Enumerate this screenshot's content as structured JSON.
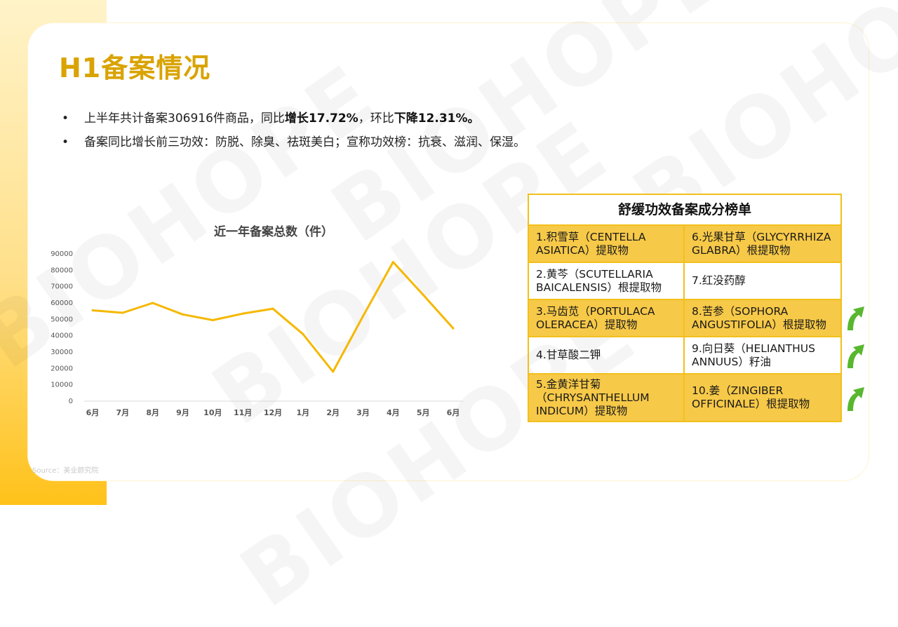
{
  "page": {
    "title": "H1备案情况",
    "source": "Source：美业颜究院",
    "watermark": "BIOHOPE"
  },
  "bullets": [
    {
      "parts": [
        {
          "text": "上半年共计备案306916件商品，同比",
          "bold": false
        },
        {
          "text": "增长17.72%",
          "bold": true
        },
        {
          "text": "，环比",
          "bold": false
        },
        {
          "text": "下降12.31%。",
          "bold": true
        }
      ]
    },
    {
      "parts": [
        {
          "text": "备案同比增长前三功效：防脱、除臭、祛斑美白；宣称功效榜：抗衰、滋润、保湿。",
          "bold": false
        }
      ]
    }
  ],
  "chart_data": {
    "type": "line",
    "title": "近一年备案总数（件）",
    "xlabel": "",
    "ylabel": "",
    "categories": [
      "6月",
      "7月",
      "8月",
      "9月",
      "10月",
      "11月",
      "12月",
      "1月",
      "2月",
      "3月",
      "4月",
      "5月",
      "6月"
    ],
    "series": [
      {
        "values": [
          55500,
          54000,
          60000,
          53000,
          49500,
          53500,
          56500,
          41000,
          18000,
          52000,
          85000,
          65000,
          44500
        ]
      }
    ],
    "ylim": [
      0,
      90000
    ],
    "yticks": [
      0,
      10000,
      20000,
      30000,
      40000,
      50000,
      60000,
      70000,
      80000,
      90000
    ],
    "line_color": "#f5b800",
    "grid": false
  },
  "table": {
    "title": "舒缓功效备案成分榜单",
    "rows": [
      {
        "left": "1.积雪草（CENTELLA ASIATICA）提取物",
        "right": "6.光果甘草（GLYCYRRHIZA GLABRA）根提取物",
        "trend": null
      },
      {
        "left": "2.黄芩（SCUTELLARIA BAICALENSIS）根提取物",
        "right": "7.红没药醇",
        "trend": null
      },
      {
        "left": "3.马齿苋（PORTULACA OLERACEA）提取物",
        "right": "8.苦参（SOPHORA ANGUSTIFOLIA）根提取物",
        "trend": "up"
      },
      {
        "left": "4.甘草酸二钾",
        "right": "9.向日葵（HELIANTHUS ANNUUS）籽油",
        "trend": "up"
      },
      {
        "left": "5.金黄洋甘菊（CHRYSANTHELLUM INDICUM）提取物",
        "right": "10.姜（ZINGIBER OFFICINALE）根提取物",
        "trend": "up"
      }
    ]
  },
  "colors": {
    "accent": "#d9a300",
    "table_border": "#f2c01b",
    "table_alt_row": "#f7c948",
    "arrow": "#58b72e"
  },
  "icons": {
    "trend_up": "green-up-arrow-icon"
  }
}
